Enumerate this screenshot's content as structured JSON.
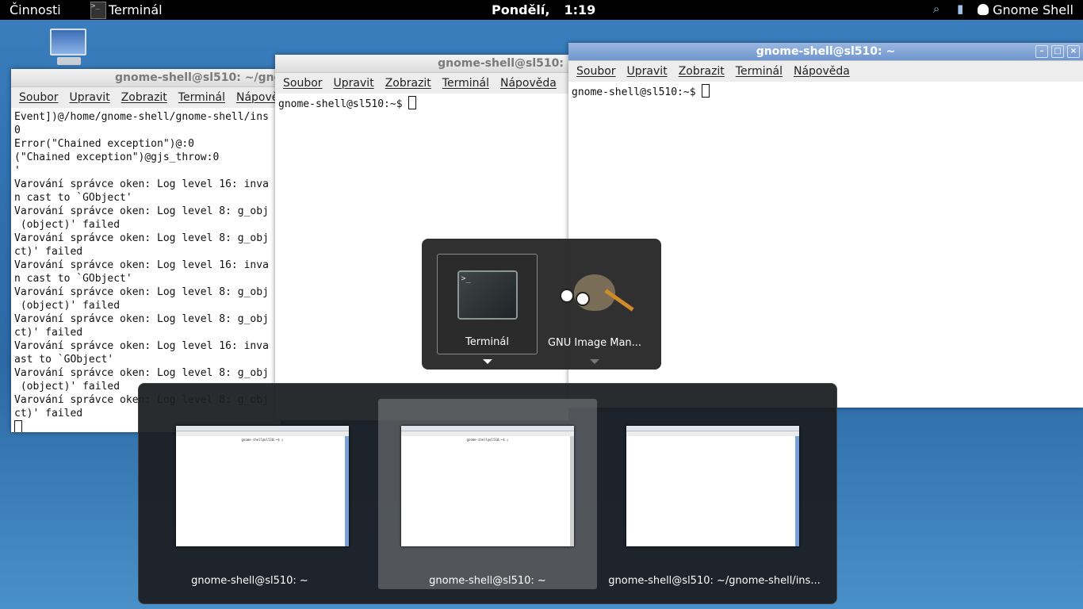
{
  "panel": {
    "activities": "Činnosti",
    "app_menu": "Terminál",
    "clock_day": "Pondělí,",
    "clock_time": "1:19",
    "user": "Gnome Shell"
  },
  "windows": {
    "left": {
      "title": "gnome-shell@sl510: ~/gnome-shell/ins…",
      "menu": [
        "Soubor",
        "Upravit",
        "Zobrazit",
        "Terminál",
        "Nápověda"
      ],
      "lines": [
        "Event])@/home/gnome-shell/gnome-shell/ins",
        "0",
        "Error(\"Chained exception\")@:0",
        "(\"Chained exception\")@gjs_throw:0",
        "'",
        "Varování správce oken: Log level 16: inva",
        "n cast to `GObject'",
        "Varování správce oken: Log level 8: g_obj",
        " (object)' failed",
        "Varování správce oken: Log level 8: g_obj",
        "ct)' failed",
        "Varování správce oken: Log level 16: inva",
        "n cast to `GObject'",
        "Varování správce oken: Log level 8: g_obj",
        " (object)' failed",
        "Varování správce oken: Log level 8: g_obj",
        "ct)' failed",
        "Varování správce oken: Log level 16: inva",
        "ast to `GObject'",
        "Varování správce oken: Log level 8: g_obj",
        " (object)' failed",
        "Varování správce oken: Log level 8: g_obj",
        "ct)' failed"
      ]
    },
    "middle": {
      "title": "gnome-shell@sl510:",
      "menu": [
        "Soubor",
        "Upravit",
        "Zobrazit",
        "Terminál",
        "Nápověda"
      ],
      "prompt": "gnome-shell@sl510:~$ "
    },
    "right": {
      "title": "gnome-shell@sl510: ~",
      "menu": [
        "Soubor",
        "Upravit",
        "Zobrazit",
        "Terminál",
        "Nápověda"
      ],
      "prompt": "gnome-shell@sl510:~$ "
    }
  },
  "switcher": {
    "apps": [
      {
        "label": "Terminál",
        "icon": "terminal-icon",
        "selected": true
      },
      {
        "label": "GNU Image Man...",
        "icon": "gimp-icon",
        "selected": false
      }
    ]
  },
  "thumbnails": [
    {
      "label": "gnome-shell@sl510: ~",
      "selected": false
    },
    {
      "label": "gnome-shell@sl510: ~",
      "selected": true
    },
    {
      "label": "gnome-shell@sl510: ~/gnome-shell/ins...",
      "selected": false
    }
  ],
  "colors": {
    "panel_bg": "#000000",
    "active_title": "#6f96cf",
    "desktop": "#2f6fae"
  }
}
